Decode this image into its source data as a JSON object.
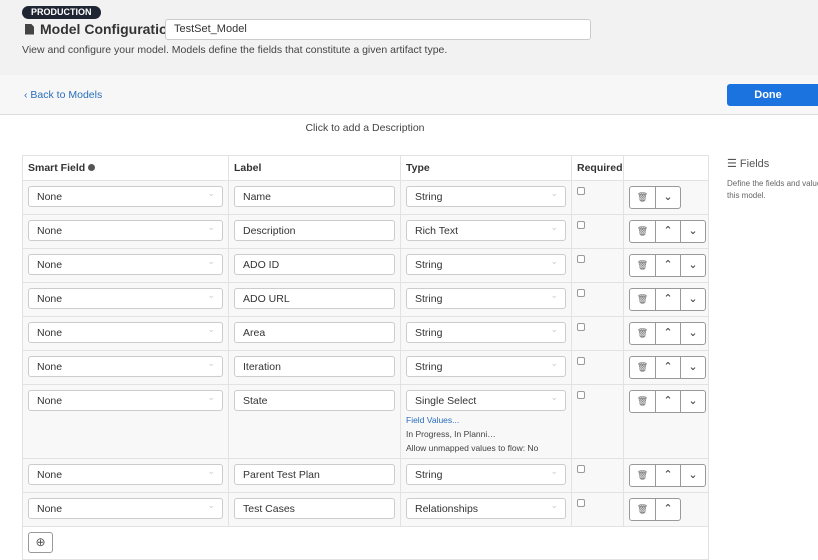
{
  "header": {
    "badge": "PRODUCTION",
    "title": "Model Configuration",
    "model_name": "TestSet_Model",
    "subtitle": "View and configure your model. Models define the fields that constitute a given artifact type."
  },
  "nav": {
    "back": "Back to Models",
    "done": "Done"
  },
  "description_placeholder": "Click to add a Description",
  "table": {
    "headers": [
      "Smart Field",
      "Label",
      "Type",
      "Required"
    ],
    "rows": [
      {
        "smart": "None",
        "label": "Name",
        "type": "String",
        "required": false,
        "up": false,
        "down": true
      },
      {
        "smart": "None",
        "label": "Description",
        "type": "Rich Text",
        "required": false,
        "up": true,
        "down": true
      },
      {
        "smart": "None",
        "label": "ADO ID",
        "type": "String",
        "required": false,
        "up": true,
        "down": true
      },
      {
        "smart": "None",
        "label": "ADO URL",
        "type": "String",
        "required": false,
        "up": true,
        "down": true
      },
      {
        "smart": "None",
        "label": "Area",
        "type": "String",
        "required": false,
        "up": true,
        "down": true
      },
      {
        "smart": "None",
        "label": "Iteration",
        "type": "String",
        "required": false,
        "up": true,
        "down": true
      },
      {
        "smart": "None",
        "label": "State",
        "type": "Single Select",
        "required": false,
        "up": true,
        "down": true,
        "field_values_link": "Field Values...",
        "values_summary": "In Progress, In Planni…",
        "unmapped": "Allow unmapped values to flow: No"
      },
      {
        "smart": "None",
        "label": "Parent Test Plan",
        "type": "String",
        "required": false,
        "up": true,
        "down": true
      },
      {
        "smart": "None",
        "label": "Test Cases",
        "type": "Relationships",
        "required": false,
        "up": true,
        "down": false
      }
    ]
  },
  "sidebar": {
    "title": "Fields",
    "text": "Define the fields and values for this model."
  }
}
